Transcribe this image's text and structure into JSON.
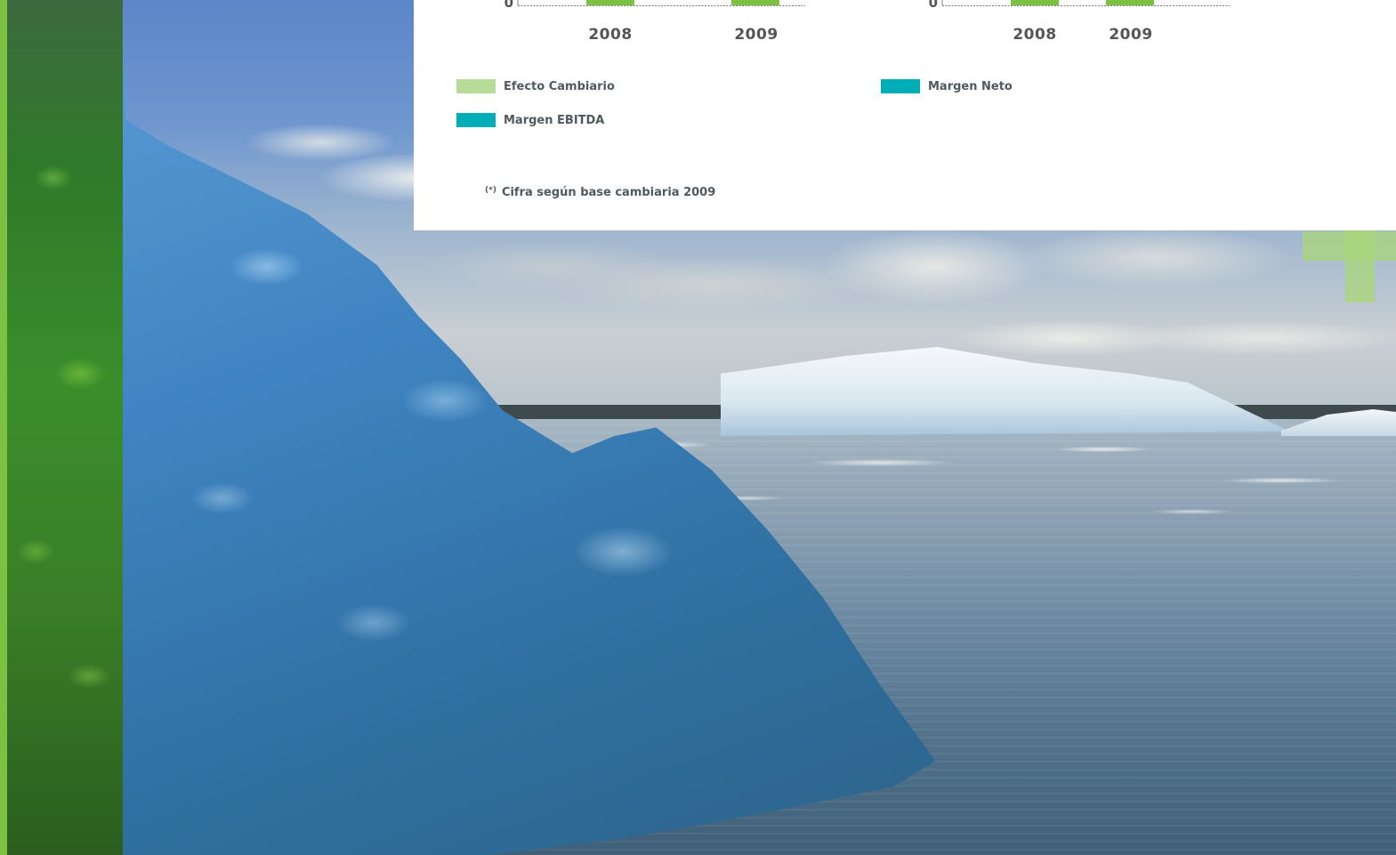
{
  "colors": {
    "bar": "#7cc142",
    "efecto_cambiario": "#b6dc97",
    "margen": "#00aeb7",
    "axis_text": "#555555",
    "accent_green": "#7cc142"
  },
  "chart_data": [
    {
      "type": "bar",
      "categories": [
        "2008",
        "2009"
      ],
      "values": [
        null,
        null
      ],
      "yticks": [
        "0"
      ],
      "title": "",
      "xlabel": "",
      "ylabel": "",
      "legend": [
        "Efecto Cambiario",
        "Margen EBITDA"
      ],
      "legend_placement": "bottom-left"
    },
    {
      "type": "bar",
      "categories": [
        "2008",
        "2009"
      ],
      "values": [
        null,
        null
      ],
      "yticks": [
        "0"
      ],
      "title": "",
      "xlabel": "",
      "ylabel": "",
      "legend": [
        "Margen Neto"
      ],
      "legend_placement": "bottom-left"
    }
  ],
  "legend": {
    "efecto_cambiario": "Efecto Cambiario",
    "margen_ebitda": "Margen EBITDA",
    "margen_neto": "Margen Neto"
  },
  "footnote": {
    "marker": "(*)",
    "text": "Cifra según base cambiaria 2009"
  }
}
